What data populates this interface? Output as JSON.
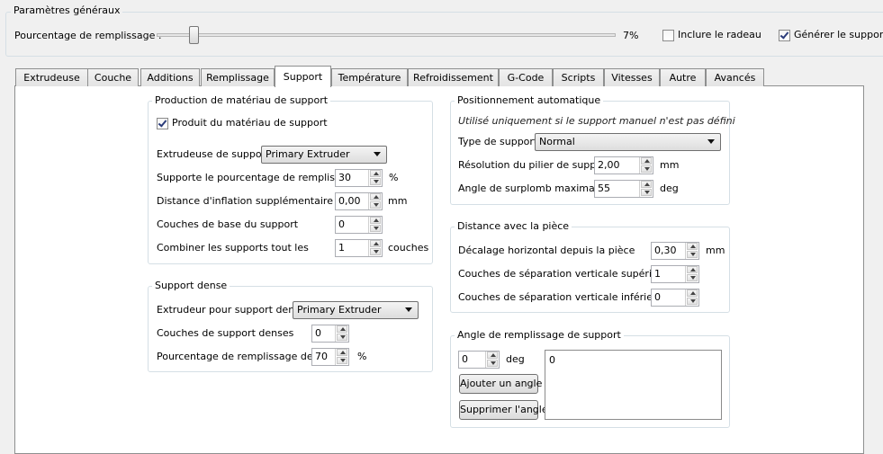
{
  "general": {
    "title": "Paramètres généraux",
    "fill_label": "Pourcentage de remplissage :",
    "fill_value": "7%",
    "fill_fraction": 0.07,
    "raft_label": "Inclure le radeau",
    "raft_checked": false,
    "support_label": "Générer le support",
    "support_checked": true
  },
  "tabs": [
    {
      "label": "Extrudeuse",
      "active": false
    },
    {
      "label": "Couche",
      "active": false
    },
    {
      "label": "Additions",
      "active": false
    },
    {
      "label": "Remplissage",
      "active": false
    },
    {
      "label": "Support",
      "active": true
    },
    {
      "label": "Température",
      "active": false
    },
    {
      "label": "Refroidissement",
      "active": false
    },
    {
      "label": "G-Code",
      "active": false
    },
    {
      "label": "Scripts",
      "active": false
    },
    {
      "label": "Vitesses",
      "active": false
    },
    {
      "label": "Autre",
      "active": false
    },
    {
      "label": "Avancés",
      "active": false
    }
  ],
  "production": {
    "title": "Production de matériau de support",
    "produce_label": "Produit du matériau de support",
    "produce_checked": true,
    "extruder_label": "Extrudeuse de support",
    "extruder_value": "Primary Extruder",
    "fill_pct_label": "Supporte le pourcentage de remplissage",
    "fill_pct_value": "30",
    "fill_pct_unit": "%",
    "inflation_label": "Distance d'inflation supplémentaire",
    "inflation_value": "0,00",
    "inflation_unit": "mm",
    "base_layers_label": "Couches de base du support",
    "base_layers_value": "0",
    "combine_label": "Combiner les supports tout les",
    "combine_value": "1",
    "combine_unit": "couches"
  },
  "dense": {
    "title": "Support dense",
    "extruder_label": "Extrudeur pour support dense",
    "extruder_value": "Primary Extruder",
    "layers_label": "Couches de support denses",
    "layers_value": "0",
    "fill_label": "Pourcentage de remplissage dense",
    "fill_value": "70",
    "fill_unit": "%"
  },
  "positioning": {
    "title": "Positionnement automatique",
    "note": "Utilisé uniquement si le support manuel n'est pas défini",
    "type_label": "Type de support",
    "type_value": "Normal",
    "resolution_label": "Résolution du pilier de support",
    "resolution_value": "2,00",
    "resolution_unit": "mm",
    "angle_label": "Angle de surplomb maximal",
    "angle_value": "55",
    "angle_unit": "deg"
  },
  "distance": {
    "title": "Distance avec la pièce",
    "horizontal_label": "Décalage horizontal depuis la pièce",
    "horizontal_value": "0,30",
    "horizontal_unit": "mm",
    "top_label": "Couches de séparation verticale supérieure",
    "top_value": "1",
    "bottom_label": "Couches de séparation verticale inférieure",
    "bottom_value": "0"
  },
  "fill_angle": {
    "title": "Angle de remplissage de support",
    "angle_value": "0",
    "angle_unit": "deg",
    "add_button": "Ajouter un angle",
    "remove_button": "Supprimer l'angle",
    "list_items": [
      "0"
    ]
  }
}
